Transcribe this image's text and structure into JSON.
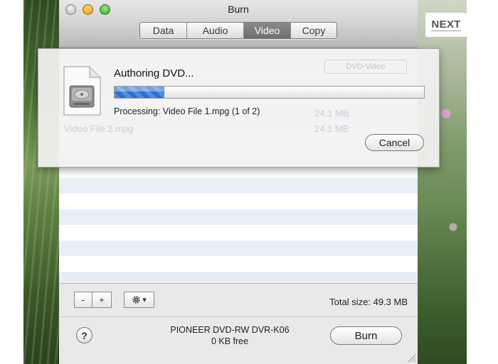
{
  "window": {
    "title": "Burn"
  },
  "tabs": [
    {
      "label": "Data",
      "active": false
    },
    {
      "label": "Audio",
      "active": false
    },
    {
      "label": "Video",
      "active": true
    },
    {
      "label": "Copy",
      "active": false
    }
  ],
  "desktop": {
    "next_label": "NEXT"
  },
  "sheet": {
    "title": "Authoring DVD...",
    "progress": 0.16,
    "status": "Processing: Video File 1.mpg (1 of 2)",
    "cancel_label": "Cancel",
    "background_rows": [
      {
        "name": "",
        "size": "24.1 MB"
      },
      {
        "name": "Video File 2.mpg",
        "size": "24.1 MB"
      }
    ],
    "background_popup": "DVD-Video"
  },
  "bottom": {
    "remove_label": "-",
    "add_label": "+",
    "action_label": "▾",
    "total_size": "Total size: 49.3 MB",
    "help_label": "?",
    "drive_name": "PIONEER DVD-RW DVR-K06",
    "drive_free": "0 KB free",
    "burn_label": "Burn"
  },
  "icons": {
    "action": "gear-icon",
    "sheet": "disc-image-document-icon"
  }
}
